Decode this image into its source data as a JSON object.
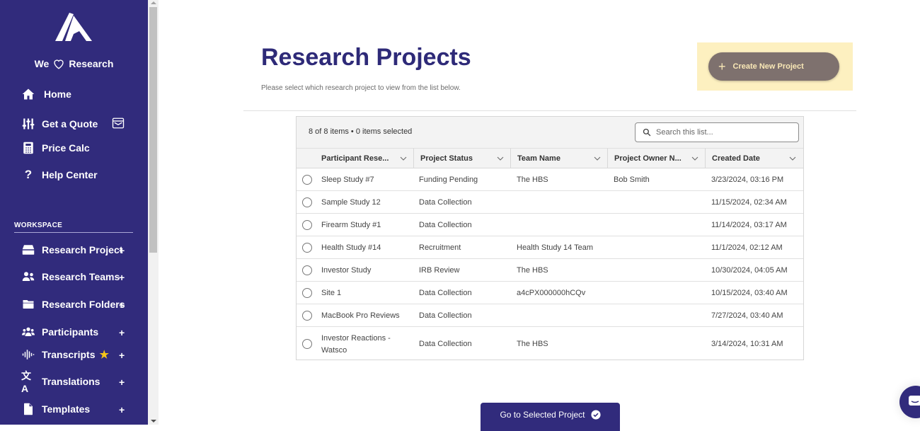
{
  "sidebar": {
    "tagline_pre": "We",
    "tagline_post": "Research",
    "top_items": [
      {
        "label": "Home",
        "icon": "home-icon"
      },
      {
        "label": "Get a Quote",
        "icon": "sliders-icon",
        "badge_icon": "wallet-icon"
      },
      {
        "label": "Price Calc",
        "icon": "calculator-icon"
      },
      {
        "label": "Help Center",
        "icon": "question-icon"
      }
    ],
    "workspace_label": "WORKSPACE",
    "workspace_items": [
      {
        "label": "Research Project",
        "icon": "drive-icon",
        "action": "+"
      },
      {
        "label": "Research Teams",
        "icon": "users-icon",
        "action": "+"
      },
      {
        "label": "Research Folders",
        "icon": "folder-icon",
        "action": "+"
      },
      {
        "label": "Participants",
        "icon": "people-group-icon",
        "action": "+"
      },
      {
        "label": "Transcripts",
        "icon": "audio-wave-icon",
        "action": "+",
        "star": "★"
      },
      {
        "label": "Translations",
        "icon": "language-icon",
        "action": "+"
      },
      {
        "label": "Templates",
        "icon": "file-icon",
        "action": "+"
      }
    ]
  },
  "header": {
    "title": "Research Projects",
    "subtitle": "Please select which research project to view from the list below.",
    "create_button": "Create New Project",
    "create_icon": "+"
  },
  "table": {
    "count_text": "8 of 8 items • 0 items selected",
    "search_placeholder": "Search this list...",
    "columns": [
      "Participant Rese...",
      "Project Status",
      "Team Name",
      "Project Owner N...",
      "Created Date"
    ],
    "rows": [
      {
        "name": "Sleep Study #7",
        "status": "Funding Pending",
        "team": "The HBS",
        "owner": "Bob Smith",
        "created": "3/23/2024, 03:16 PM"
      },
      {
        "name": "Sample Study 12",
        "status": "Data Collection",
        "team": "",
        "owner": "",
        "created": "11/15/2024, 02:34 AM"
      },
      {
        "name": "Firearm Study #1",
        "status": "Data Collection",
        "team": "",
        "owner": "",
        "created": "11/14/2024, 03:17 AM"
      },
      {
        "name": "Health Study #14",
        "status": "Recruitment",
        "team": "Health Study 14 Team",
        "owner": "",
        "created": "11/1/2024, 02:12 AM"
      },
      {
        "name": "Investor Study",
        "status": "IRB Review",
        "team": "The HBS",
        "owner": "",
        "created": "10/30/2024, 04:05 AM"
      },
      {
        "name": "Site 1",
        "status": "Data Collection",
        "team": "a4cPX000000hCQv",
        "owner": "",
        "created": "10/15/2024, 03:40 AM"
      },
      {
        "name": "MacBook Pro Reviews",
        "status": "Data Collection",
        "team": "",
        "owner": "",
        "created": "7/27/2024, 03:40 AM"
      },
      {
        "name": "Investor Reactions - Watsco",
        "status": "Data Collection",
        "team": "The HBS",
        "owner": "",
        "created": "3/14/2024, 10:31 AM"
      }
    ]
  },
  "footer": {
    "go_button": "Go to Selected Project"
  },
  "colors": {
    "brand": "#312b7c",
    "title": "#2e2a78",
    "create_bg": "#7e716e",
    "create_text": "#f9e8b6",
    "create_highlight": "#fdf0c0",
    "star": "#f5c518"
  }
}
